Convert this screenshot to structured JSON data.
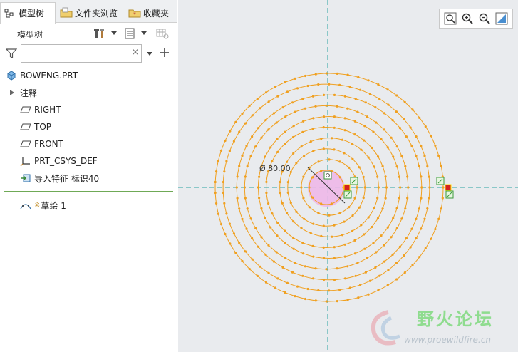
{
  "tabs": [
    {
      "label": "模型树",
      "icon": "model-tree-icon",
      "active": true
    },
    {
      "label": "文件夹浏览",
      "icon": "folder-icon",
      "active": false
    },
    {
      "label": "收藏夹",
      "icon": "favorites-icon",
      "active": false
    }
  ],
  "panel": {
    "title": "模型树",
    "search": {
      "value": "",
      "placeholder": ""
    }
  },
  "tree": {
    "root": "BOWENG.PRT",
    "items": [
      {
        "label": "注释",
        "icon": "expand-arrow-icon"
      },
      {
        "label": "RIGHT",
        "icon": "datum-plane-icon"
      },
      {
        "label": "TOP",
        "icon": "datum-plane-icon"
      },
      {
        "label": "FRONT",
        "icon": "datum-plane-icon"
      },
      {
        "label": "PRT_CSYS_DEF",
        "icon": "csys-icon"
      },
      {
        "label": "导入特征 标识40",
        "icon": "import-feature-icon"
      }
    ],
    "sketch": {
      "marker": "※",
      "label": "草绘 1",
      "icon": "sketch-icon"
    }
  },
  "sketch": {
    "diameter_label": "Ø 80.00",
    "ring_count": 10,
    "colors": {
      "curve": "#f0a020",
      "centerline": "#2aa3a3",
      "fill": "#eeb8e8",
      "handle": "#d42020",
      "constraint": "#3a9a3a"
    }
  },
  "watermark": {
    "title": "野火论坛",
    "url": "www.proewildfire.cn"
  },
  "colors": {
    "accent": "#6fa956",
    "viewport_bg": "#e9ebee"
  }
}
